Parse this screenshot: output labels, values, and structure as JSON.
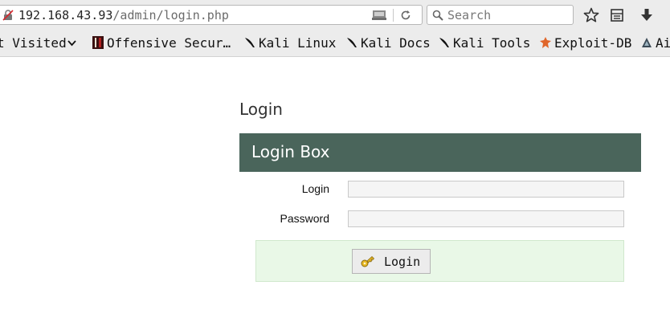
{
  "urlbar": {
    "host": "192.168.43.93",
    "path": "/admin/login.php"
  },
  "search": {
    "placeholder": "Search"
  },
  "bookmarks": [
    {
      "label": "t Visited",
      "icon": "chevron-down-icon"
    },
    {
      "label": "Offensive Secur…",
      "icon": "offsec-logo-icon"
    },
    {
      "label": "Kali Linux",
      "icon": "kali-dragon-icon"
    },
    {
      "label": "Kali Docs",
      "icon": "kali-dragon-icon"
    },
    {
      "label": "Kali Tools",
      "icon": "kali-dragon-icon"
    },
    {
      "label": "Exploit-DB",
      "icon": "exploit-db-icon"
    },
    {
      "label": "Ai",
      "icon": "aircrack-icon"
    }
  ],
  "page": {
    "heading": "Login",
    "box_title": "Login Box",
    "login_label": "Login",
    "password_label": "Password",
    "login_value": "",
    "password_value": "",
    "submit_label": "Login"
  },
  "colors": {
    "box_header": "#4a655b",
    "submit_area": "#e9f8e7"
  }
}
